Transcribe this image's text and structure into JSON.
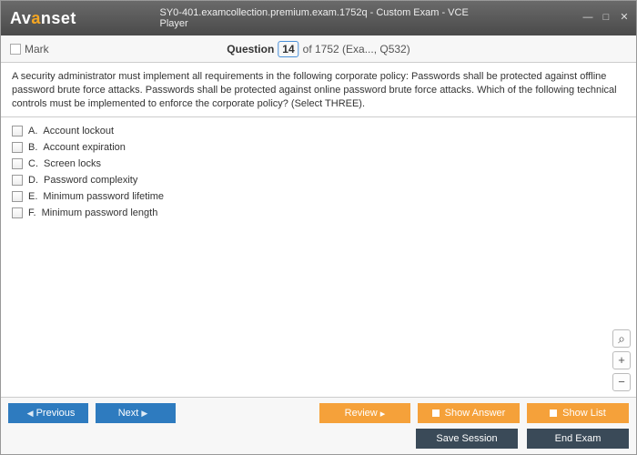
{
  "titlebar": {
    "logo_prefix": "Av",
    "logo_accent": "a",
    "logo_mid": "ns",
    "logo_suffix": "et",
    "title": "SY0-401.examcollection.premium.exam.1752q - Custom Exam - VCE Player"
  },
  "toolbar": {
    "mark_label": "Mark",
    "question_word": "Question",
    "question_number": "14",
    "question_total": "of 1752 (Exa..., Q532)"
  },
  "question": {
    "text": "A security administrator must implement all requirements in the following corporate policy: Passwords shall be protected against offline password brute force attacks. Passwords shall be protected against online password brute force attacks. Which of the following technical controls must be implemented to enforce the corporate policy? (Select THREE)."
  },
  "options": [
    {
      "letter": "A.",
      "text": "Account lockout"
    },
    {
      "letter": "B.",
      "text": "Account expiration"
    },
    {
      "letter": "C.",
      "text": "Screen locks"
    },
    {
      "letter": "D.",
      "text": "Password complexity"
    },
    {
      "letter": "E.",
      "text": "Minimum password lifetime"
    },
    {
      "letter": "F.",
      "text": "Minimum password length"
    }
  ],
  "footer": {
    "previous": "Previous",
    "next": "Next",
    "review": "Review",
    "show_answer": "Show Answer",
    "show_list": "Show List",
    "save_session": "Save Session",
    "end_exam": "End Exam"
  }
}
